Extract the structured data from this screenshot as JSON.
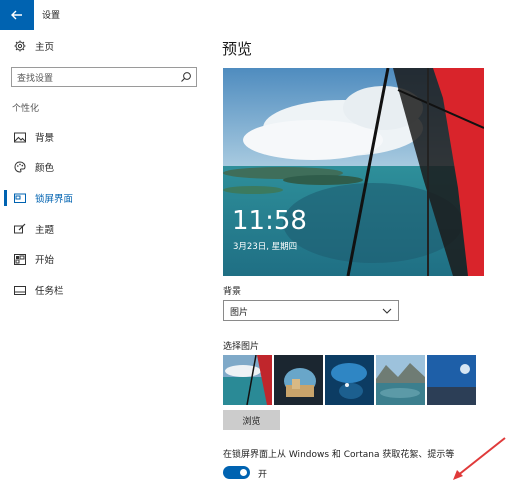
{
  "window": {
    "title": "设置"
  },
  "sidebar": {
    "home_label": "主页",
    "search_placeholder": "查找设置",
    "section_label": "个性化",
    "items": [
      {
        "label": "背景",
        "icon": "picture-icon",
        "active": false
      },
      {
        "label": "颜色",
        "icon": "palette-icon",
        "active": false
      },
      {
        "label": "锁屏界面",
        "icon": "lock-screen-icon",
        "active": true
      },
      {
        "label": "主题",
        "icon": "brush-icon",
        "active": false
      },
      {
        "label": "开始",
        "icon": "start-icon",
        "active": false
      },
      {
        "label": "任务栏",
        "icon": "taskbar-icon",
        "active": false
      }
    ]
  },
  "main": {
    "title": "预览",
    "preview": {
      "time": "11:58",
      "date": "3月23日, 星期四"
    },
    "background_label": "背景",
    "background_value": "图片",
    "choose_picture_label": "选择图片",
    "browse_label": "浏览",
    "bottom_text": "在锁屏界面上从 Windows 和 Cortana 获取花絮、提示等",
    "toggle_state": "开"
  },
  "colors": {
    "accent": "#0063b1",
    "button": "#cccccc"
  }
}
